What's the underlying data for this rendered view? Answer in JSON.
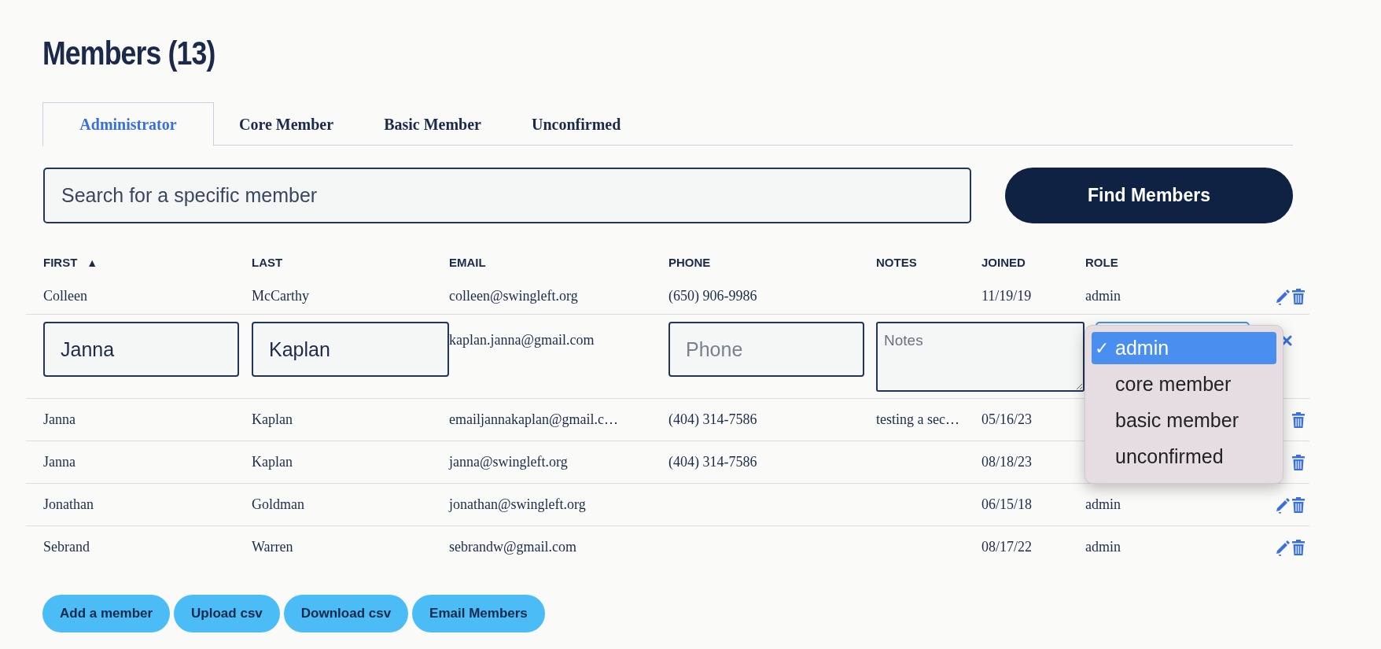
{
  "page": {
    "title": "Members (13)"
  },
  "tabs": [
    {
      "label": "Administrator",
      "selected": true
    },
    {
      "label": "Core Member",
      "selected": false
    },
    {
      "label": "Basic Member",
      "selected": false
    },
    {
      "label": "Unconfirmed",
      "selected": false
    }
  ],
  "search": {
    "placeholder": "Search for a specific member",
    "button": "Find Members"
  },
  "table": {
    "columns": [
      {
        "label": "FIRST",
        "sort_indicator": "▲"
      },
      {
        "label": "LAST"
      },
      {
        "label": "EMAIL"
      },
      {
        "label": "PHONE"
      },
      {
        "label": "NOTES"
      },
      {
        "label": "JOINED"
      },
      {
        "label": "ROLE"
      }
    ],
    "rows": [
      {
        "kind": "view",
        "first": "Colleen",
        "last": "McCarthy",
        "email": "colleen@swingleft.org",
        "phone": "(650) 906-9986",
        "joined": "11/19/19",
        "role": "admin",
        "edit_shown": true,
        "delete_shown": true
      },
      {
        "kind": "edit",
        "first": "Janna",
        "last": "Kaplan",
        "email": "kaplan.janna@gmail.com",
        "phone_placeholder": "Phone",
        "notes_placeholder": "Notes",
        "role_menu": [
          {
            "label": "admin",
            "selected": true,
            "mark": "✓"
          },
          {
            "label": "core member",
            "selected": false
          },
          {
            "label": "basic member",
            "selected": false
          },
          {
            "label": "unconfirmed",
            "selected": false
          }
        ]
      },
      {
        "kind": "view",
        "first": "Janna",
        "last": "Kaplan",
        "email": "emailjannakaplan@gmail.c…",
        "phone": "(404) 314-7586",
        "notes": "testing a sec…",
        "joined": "05/16/23",
        "edit_shown": false,
        "delete_shown": true
      },
      {
        "kind": "view",
        "first": "Janna",
        "last": "Kaplan",
        "email": "janna@swingleft.org",
        "phone": "(404) 314-7586",
        "joined": "08/18/23",
        "edit_shown": false,
        "delete_shown": true
      },
      {
        "kind": "view",
        "first": "Jonathan",
        "last": "Goldman",
        "email": "jonathan@swingleft.org",
        "joined": "06/15/18",
        "role": "admin",
        "edit_shown": true,
        "delete_shown": true
      },
      {
        "kind": "view",
        "first": "Sebrand",
        "last": "Warren",
        "email": "sebrandw@gmail.com",
        "joined": "08/17/22",
        "role": "admin",
        "edit_shown": true,
        "delete_shown": true
      }
    ]
  },
  "buttons": [
    "Add a member",
    "Upload csv",
    "Download csv",
    "Email Members"
  ]
}
